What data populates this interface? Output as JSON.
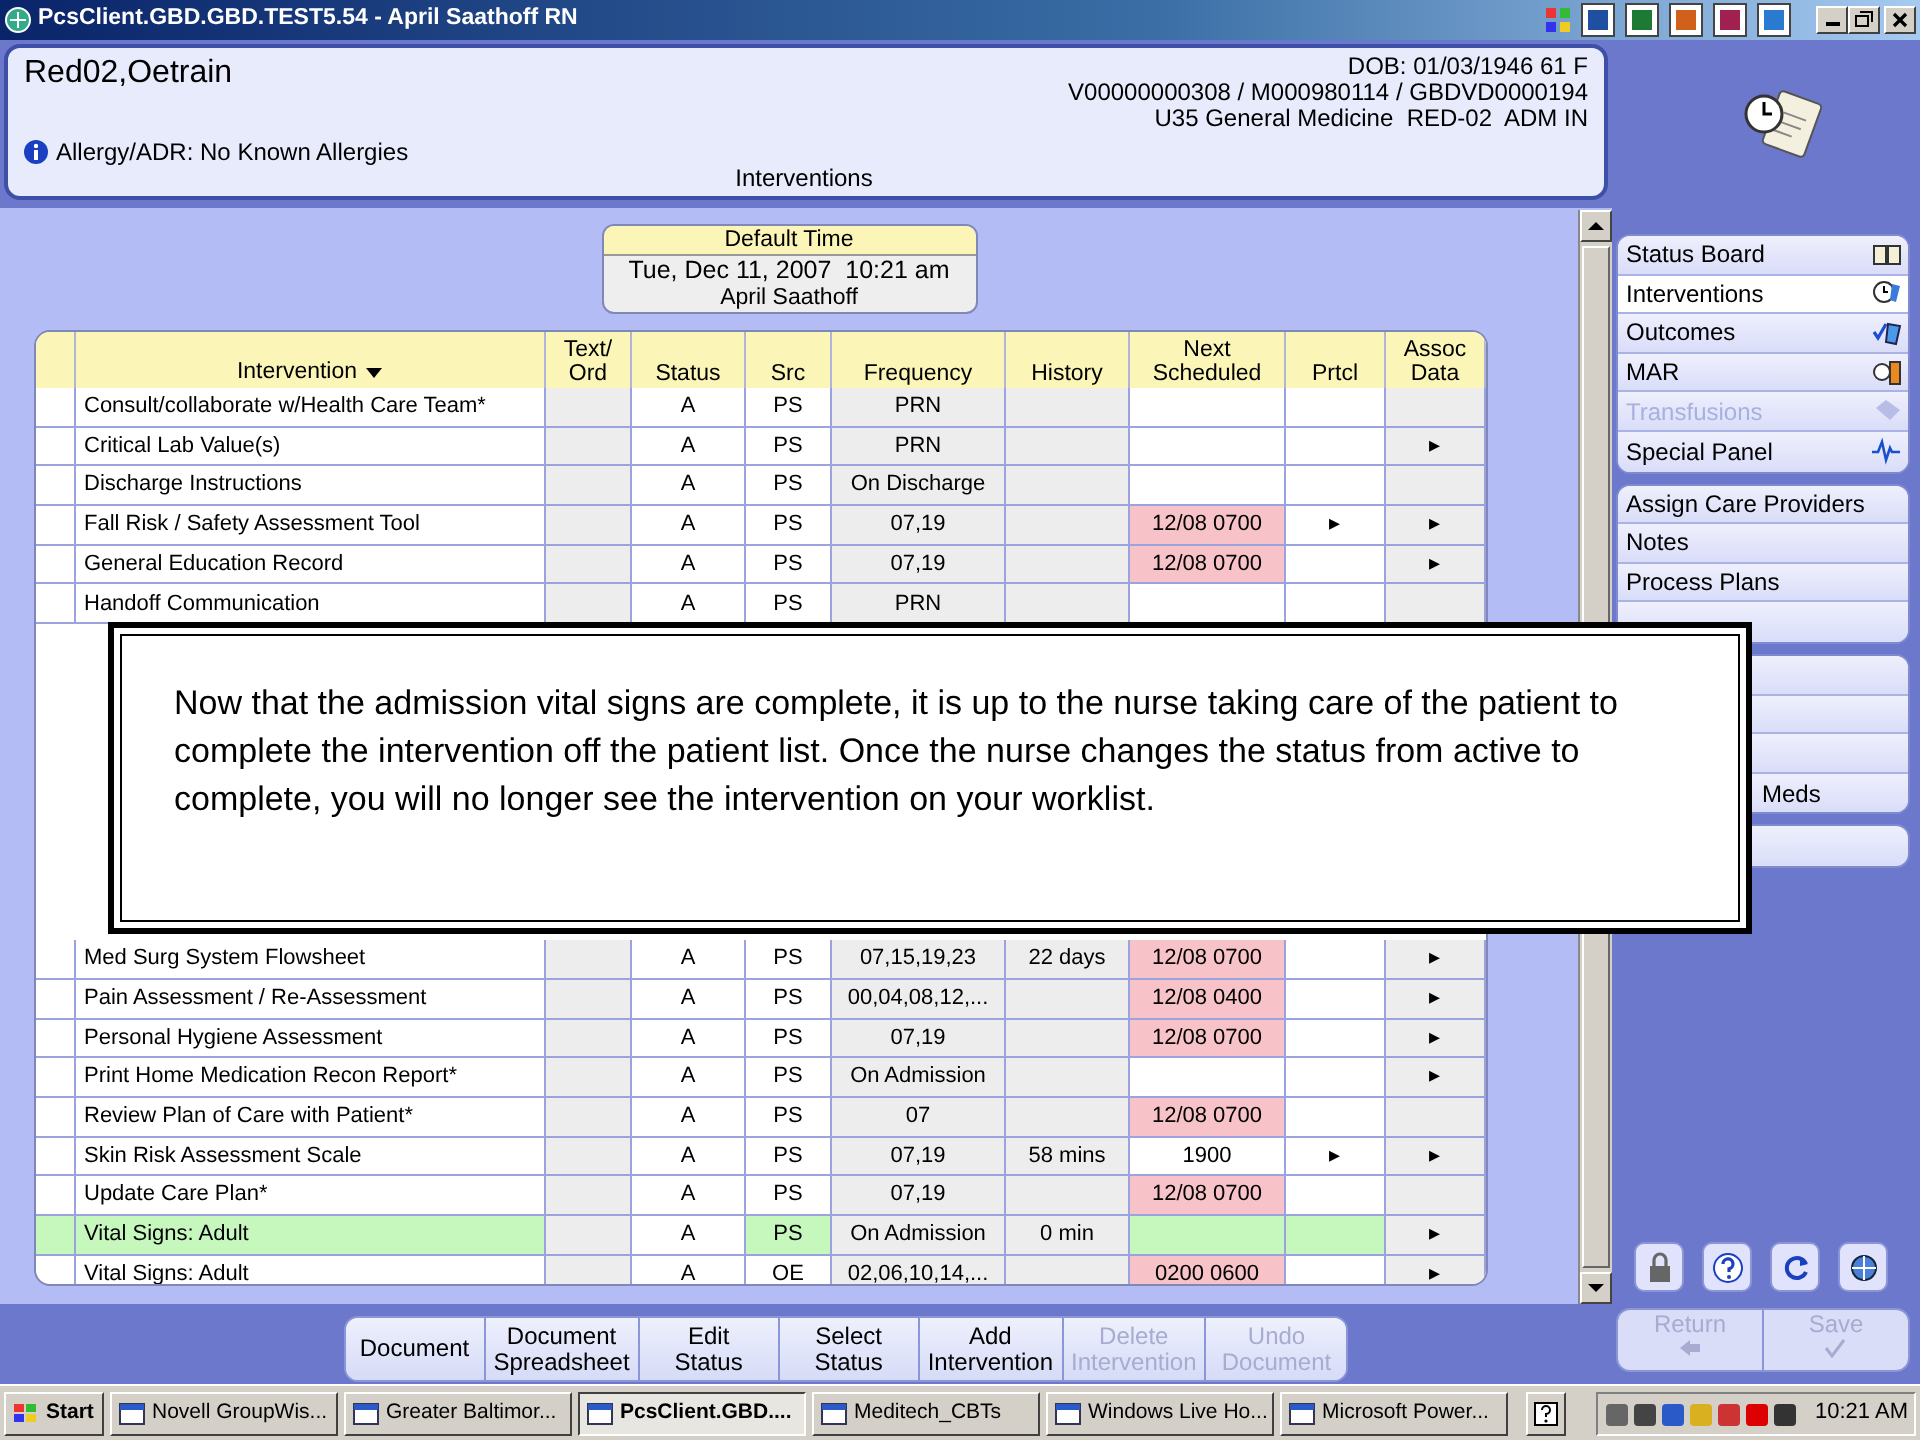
{
  "window": {
    "title": "PcsClient.GBD.GBD.TEST5.54 - April Saathoff RN"
  },
  "patient": {
    "name": "Red02,Oetrain",
    "dob": "DOB: 01/03/1946 61 F",
    "ids": "V00000000308 / M000980114 / GBDVD0000194",
    "location": "U35 General Medicine  RED-02  ADM IN",
    "allergy": "Allergy/ADR: No Known Allergies",
    "screen": "Interventions"
  },
  "default_time": {
    "label": "Default Time",
    "datetime": "Tue, Dec 11, 2007  10:21 am",
    "user": "April Saathoff"
  },
  "table": {
    "columns": [
      {
        "label": "Intervention",
        "sorted": true
      },
      {
        "label": "Text/\nOrd",
        "sorted": false
      },
      {
        "label": "Status",
        "sorted": false
      },
      {
        "label": "Src",
        "sorted": false
      },
      {
        "label": "Frequency",
        "sorted": false
      },
      {
        "label": "History",
        "sorted": false
      },
      {
        "label": "Next\nScheduled",
        "sorted": false
      },
      {
        "label": "Prtcl",
        "sorted": false
      },
      {
        "label": "Assoc\nData",
        "sorted": false
      }
    ],
    "rows_above_note": [
      {
        "name": "Consult/collaborate w/Health Care Team*",
        "status": "A",
        "src": "PS",
        "frequency": "PRN",
        "due": false,
        "highlighted": false
      },
      {
        "name": "Critical Lab Value(s)",
        "status": "A",
        "src": "PS",
        "frequency": "PRN",
        "assoc": "▸",
        "due": false,
        "highlighted": false
      },
      {
        "name": "Discharge Instructions",
        "status": "A",
        "src": "PS",
        "frequency": "On Discharge",
        "due": false,
        "highlighted": false
      },
      {
        "name": "Fall Risk / Safety Assessment Tool",
        "status": "A",
        "src": "PS",
        "frequency": "07,19",
        "next": "12/08 0700",
        "prtcl": "▸",
        "assoc": "▸",
        "due": true,
        "highlighted": false
      },
      {
        "name": "General Education Record",
        "status": "A",
        "src": "PS",
        "frequency": "07,19",
        "next": "12/08 0700",
        "assoc": "▸",
        "due": true,
        "highlighted": false
      },
      {
        "name": "Handoff Communication",
        "status": "A",
        "src": "PS",
        "frequency": "PRN",
        "due": false,
        "highlighted": false
      }
    ],
    "rows_below_note": [
      {
        "name": "Med Surg System Flowsheet",
        "status": "A",
        "src": "PS",
        "frequency": "07,15,19,23",
        "history": "22 days",
        "next": "12/08 0700",
        "assoc": "▸",
        "due": true,
        "highlighted": false
      },
      {
        "name": "Pain Assessment / Re-Assessment",
        "status": "A",
        "src": "PS",
        "frequency": "00,04,08,12,...",
        "next": "12/08 0400",
        "assoc": "▸",
        "due": true,
        "highlighted": false
      },
      {
        "name": "Personal Hygiene Assessment",
        "status": "A",
        "src": "PS",
        "frequency": "07,19",
        "next": "12/08 0700",
        "assoc": "▸",
        "due": true,
        "highlighted": false
      },
      {
        "name": "Print Home Medication Recon Report*",
        "status": "A",
        "src": "PS",
        "frequency": "On Admission",
        "assoc": "▸",
        "due": false,
        "highlighted": false
      },
      {
        "name": "Review Plan of Care with Patient*",
        "status": "A",
        "src": "PS",
        "frequency": "07",
        "next": "12/08 0700",
        "due": true,
        "highlighted": false
      },
      {
        "name": "Skin Risk Assessment Scale",
        "status": "A",
        "src": "PS",
        "frequency": "07,19",
        "history": "58 mins",
        "next": "1900",
        "prtcl": "▸",
        "assoc": "▸",
        "due": false,
        "highlighted": false
      },
      {
        "name": "Update Care Plan*",
        "status": "A",
        "src": "PS",
        "frequency": "07,19",
        "next": "12/08 0700",
        "due": true,
        "highlighted": false
      },
      {
        "name": "Vital Signs: Adult",
        "status": "A",
        "src": "PS",
        "frequency": "On Admission",
        "history": "0 min",
        "assoc": "▸",
        "due": false,
        "highlighted": true
      },
      {
        "name": "Vital Signs: Adult",
        "status": "A",
        "src": "OE",
        "frequency": "02,06,10,14,...",
        "next": "0200 0600",
        "assoc": "▸",
        "due": true,
        "highlighted": false
      }
    ]
  },
  "note": {
    "text": "Now that the admission vital signs are complete, it is up to the nurse taking care of the patient to complete the intervention off the patient list. Once the nurse changes the status from active to complete, you will no longer see the intervention on your worklist."
  },
  "sidebar": {
    "groups": [
      {
        "items": [
          {
            "label": "Status Board",
            "kind": "book",
            "selected": false,
            "disabled": false
          },
          {
            "label": "Interventions",
            "kind": "clock",
            "selected": true,
            "disabled": false
          },
          {
            "label": "Outcomes",
            "kind": "check",
            "selected": false,
            "disabled": false
          },
          {
            "label": "MAR",
            "kind": "pill",
            "selected": false,
            "disabled": false
          },
          {
            "label": "Transfusions",
            "kind": "tag",
            "selected": false,
            "disabled": true
          },
          {
            "label": "Special Panel",
            "kind": "wave",
            "selected": false,
            "disabled": false
          }
        ]
      },
      {
        "items": [
          {
            "label": "Assign Care Providers",
            "selected": false,
            "disabled": false
          },
          {
            "label": "Notes",
            "selected": false,
            "disabled": false
          },
          {
            "label": "Process Plans",
            "selected": false,
            "disabled": false
          },
          {
            "selected": false
          }
        ]
      },
      {
        "items": [
          {
            "selected": false
          },
          {
            "selected": false
          },
          {
            "selected": false
          },
          {
            "label": "Meds",
            "selected": false,
            "disabled": false
          }
        ]
      },
      {
        "items": [
          {
            "selected": false
          }
        ]
      }
    ],
    "tools": [
      {
        "kind": "lock"
      },
      {
        "kind": "help"
      },
      {
        "kind": "refresh"
      },
      {
        "kind": "globe"
      }
    ]
  },
  "toolbar": [
    {
      "label": "Document",
      "disabled": false
    },
    {
      "label": "Document\nSpreadsheet",
      "disabled": false
    },
    {
      "label": "Edit\nStatus",
      "disabled": false
    },
    {
      "label": "Select\nStatus",
      "disabled": false
    },
    {
      "label": "Add\nIntervention",
      "disabled": false
    },
    {
      "label": "Delete\nIntervention",
      "disabled": true
    },
    {
      "label": "Undo\nDocument",
      "disabled": true
    }
  ],
  "side_buttons": [
    {
      "label": "Return",
      "kind": "back",
      "disabled": true
    },
    {
      "label": "Save",
      "kind": "save",
      "disabled": true
    }
  ],
  "taskbar": {
    "start": "Start",
    "tasks": [
      {
        "label": "Novell GroupWis...",
        "active": false
      },
      {
        "label": "Greater Baltimor...",
        "active": false
      },
      {
        "label": "PcsClient.GBD....",
        "active": true
      },
      {
        "label": "Meditech_CBTs",
        "active": false
      },
      {
        "label": "Windows Live Ho...",
        "active": false
      },
      {
        "label": "Microsoft Power...",
        "active": false
      }
    ],
    "clock": "10:21 AM"
  }
}
